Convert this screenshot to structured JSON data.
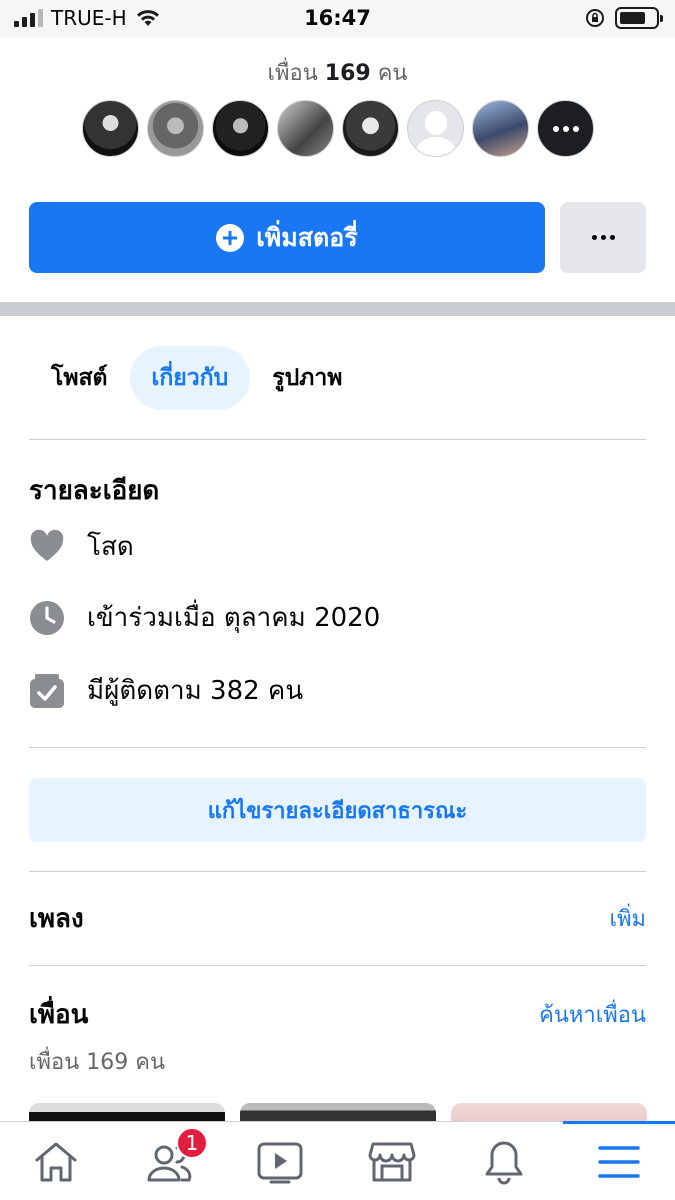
{
  "status_bar": {
    "carrier": "TRUE-H",
    "time": "16:47"
  },
  "friends_header": {
    "label": "เพื่อน",
    "count": "169",
    "unit": "คน",
    "avatars": [
      {
        "name": "friend-avatar-1"
      },
      {
        "name": "friend-avatar-2"
      },
      {
        "name": "friend-avatar-3"
      },
      {
        "name": "friend-avatar-4"
      },
      {
        "name": "friend-avatar-5"
      },
      {
        "name": "friend-avatar-6"
      },
      {
        "name": "friend-avatar-7"
      }
    ]
  },
  "actions": {
    "add_story_label": "เพิ่มสตอรี่"
  },
  "tabs": [
    {
      "label": "โพสต์",
      "active": false
    },
    {
      "label": "เกี่ยวกับ",
      "active": true
    },
    {
      "label": "รูปภาพ",
      "active": false
    }
  ],
  "details": {
    "title": "รายละเอียด",
    "relationship": "โสด",
    "joined": "เข้าร่วมเมื่อ ตุลาคม  2020",
    "followers": "มีผู้ติดตาม 382 คน",
    "edit_button": "แก้ไขรายละเอียดสาธารณะ"
  },
  "music": {
    "title": "เพลง",
    "add_link": "เพิ่ม"
  },
  "friends": {
    "title": "เพื่อน",
    "find_link": "ค้นหาเพื่อน",
    "subtitle": "เพื่อน 169 คน"
  },
  "bottom_nav": {
    "friends_badge": "1",
    "items": [
      {
        "icon": "home-icon"
      },
      {
        "icon": "friends-icon"
      },
      {
        "icon": "watch-icon"
      },
      {
        "icon": "marketplace-icon"
      },
      {
        "icon": "notifications-icon"
      },
      {
        "icon": "menu-icon"
      }
    ]
  },
  "colors": {
    "accent": "#1877f2",
    "accent_light": "#e7f3ff",
    "badge": "#e41e3f",
    "icon_gray": "#606770"
  }
}
